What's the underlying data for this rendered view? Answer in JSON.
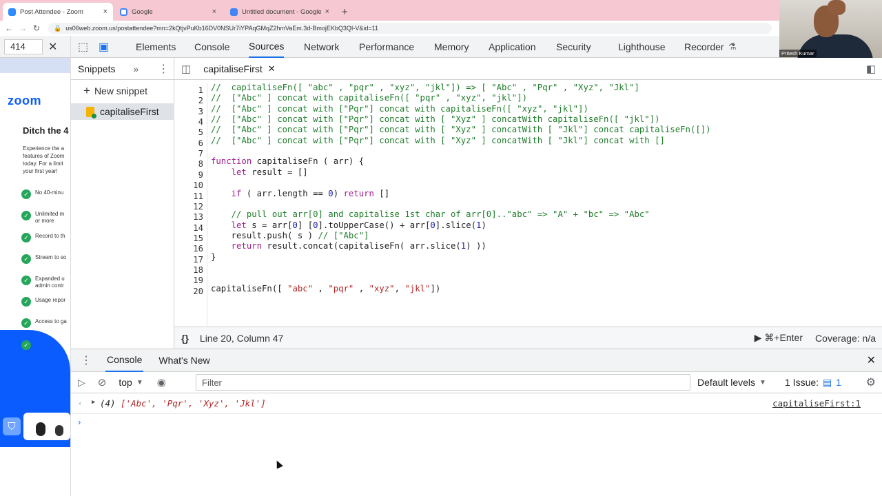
{
  "browser": {
    "tabs": [
      {
        "title": "Post Attendee - Zoom",
        "close": "×"
      },
      {
        "title": "Google",
        "close": "×"
      },
      {
        "title": "Untitled document - Google Do",
        "close": "×"
      }
    ],
    "new_tab": "+",
    "url": "us06web.zoom.us/postattendee?mn=2kQtjvPuKb16DV0NSUr7iYPAqGMqZ2hmVaEm.3d-BmojEKbQ3QI-V&id=11",
    "find_value": "414"
  },
  "zoom_page": {
    "logo": "zoom",
    "title": "Ditch the 4",
    "description": "Experience the a features of Zoom today. For a limit your first year!",
    "features": [
      "No 40-minu",
      "Unlimited m or more",
      "Record to th",
      "Stream to so",
      "Expanded u admin contr",
      "Usage repor",
      "Access to ga",
      ""
    ]
  },
  "devtools": {
    "tabs": [
      "Elements",
      "Console",
      "Sources",
      "Network",
      "Performance",
      "Memory",
      "Application",
      "Security",
      "Lighthouse",
      "Recorder"
    ],
    "active_tab": "Sources",
    "sidebar": {
      "title": "Snippets",
      "new_snippet": "New snippet",
      "items": [
        "capitaliseFirst"
      ]
    },
    "editor": {
      "file_tab": "capitaliseFirst",
      "status_position": "Line 20, Column 47",
      "run_hint": "⌘+Enter",
      "coverage": "Coverage: n/a"
    },
    "drawer": {
      "tabs": [
        "Console",
        "What's New"
      ],
      "context": "top",
      "filter_placeholder": "Filter",
      "levels": "Default levels",
      "issues_label": "1 Issue:",
      "issues_count": "1",
      "output_count": "(4)",
      "output_values": "['Abc', 'Pqr', 'Xyz', 'Jkl']",
      "output_source": "capitaliseFirst:1"
    }
  },
  "webcam": {
    "name": "Pritesh Kumar"
  },
  "code_lines": [
    {
      "n": "1",
      "html": "<span class='cm'>//  capitaliseFn([ \"abc\" , \"pqr\" , \"xyz\", \"jkl\"]) => [ \"Abc\" , \"Pqr\" , \"Xyz\", \"Jkl\"]</span>"
    },
    {
      "n": "2",
      "html": "<span class='cm'>//  [\"Abc\" ] concat with capitaliseFn([ \"pqr\" , \"xyz\", \"jkl\"])</span>"
    },
    {
      "n": "3",
      "html": "<span class='cm'>//  [\"Abc\" ] concat with [\"Pqr\"] concat with capitaliseFn([ \"xyz\", \"jkl\"])</span>"
    },
    {
      "n": "4",
      "html": "<span class='cm'>//  [\"Abc\" ] concat with [\"Pqr\"] concat with [ \"Xyz\" ] concatWith capitaliseFn([ \"jkl\"])</span>"
    },
    {
      "n": "5",
      "html": "<span class='cm'>//  [\"Abc\" ] concat with [\"Pqr\"] concat with [ \"Xyz\" ] concatWith [ \"Jkl\"] concat capitaliseFn([])</span>"
    },
    {
      "n": "6",
      "html": "<span class='cm'>//  [\"Abc\" ] concat with [\"Pqr\"] concat with [ \"Xyz\" ] concatWith [ \"Jkl\"] concat with []</span>"
    },
    {
      "n": "7",
      "html": ""
    },
    {
      "n": "8",
      "html": "<span class='kw'>function</span> capitaliseFn ( arr) {"
    },
    {
      "n": "9",
      "html": "    <span class='kw'>let</span> result = []"
    },
    {
      "n": "10",
      "html": ""
    },
    {
      "n": "11",
      "html": "    <span class='kw'>if</span> ( arr.length == <span class='nm'>0</span>) <span class='kw'>return</span> []"
    },
    {
      "n": "12",
      "html": ""
    },
    {
      "n": "13",
      "html": "    <span class='cm'>// pull out arr[0] and capitalise 1st char of arr[0]..\"abc\" => \"A\" + \"bc\" => \"Abc\"</span>"
    },
    {
      "n": "14",
      "html": "    <span class='kw'>let</span> s = arr[<span class='nm'>0</span>] [<span class='nm'>0</span>].toUpperCase() + arr[<span class='nm'>0</span>].slice(<span class='nm'>1</span>)"
    },
    {
      "n": "15",
      "html": "    result.push( s ) <span class='cm'>// [\"Abc\"]</span>"
    },
    {
      "n": "16",
      "html": "    <span class='kw'>return</span> result.concat(capitaliseFn( arr.slice(<span class='nm'>1</span>) ))"
    },
    {
      "n": "17",
      "html": "}"
    },
    {
      "n": "18",
      "html": ""
    },
    {
      "n": "19",
      "html": ""
    },
    {
      "n": "20",
      "html": "capitaliseFn([ <span class='st'>\"abc\"</span> , <span class='st'>\"pqr\"</span> , <span class='st'>\"xyz\"</span>, <span class='st'>\"jkl\"</span>])"
    }
  ]
}
